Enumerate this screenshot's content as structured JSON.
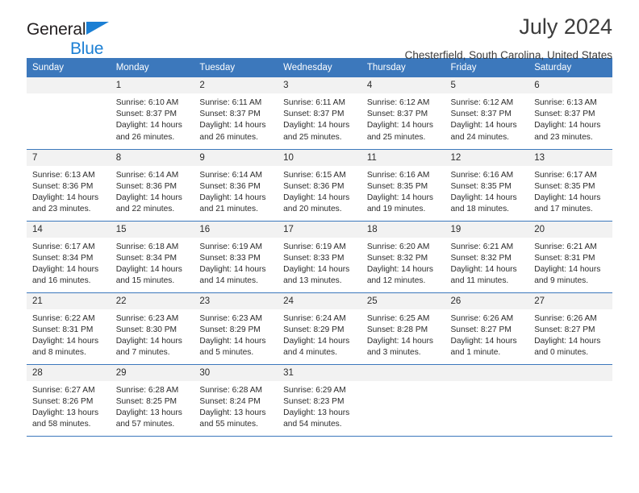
{
  "brand": {
    "name_top": "General",
    "name_bottom": "Blue",
    "triangle_color": "#1b7fd4"
  },
  "header": {
    "title": "July 2024",
    "subtitle": "Chesterfield, South Carolina, United States",
    "accent_color": "#3c78bc"
  },
  "calendar": {
    "weekdays": [
      "Sunday",
      "Monday",
      "Tuesday",
      "Wednesday",
      "Thursday",
      "Friday",
      "Saturday"
    ],
    "labels": {
      "sunrise": "Sunrise:",
      "sunset": "Sunset:",
      "daylight": "Daylight:"
    },
    "weeks": [
      [
        {
          "day": "",
          "blank": true
        },
        {
          "day": "1",
          "sunrise": "Sunrise: 6:10 AM",
          "sunset": "Sunset: 8:37 PM",
          "daylight_1": "Daylight: 14 hours",
          "daylight_2": "and 26 minutes."
        },
        {
          "day": "2",
          "sunrise": "Sunrise: 6:11 AM",
          "sunset": "Sunset: 8:37 PM",
          "daylight_1": "Daylight: 14 hours",
          "daylight_2": "and 26 minutes."
        },
        {
          "day": "3",
          "sunrise": "Sunrise: 6:11 AM",
          "sunset": "Sunset: 8:37 PM",
          "daylight_1": "Daylight: 14 hours",
          "daylight_2": "and 25 minutes."
        },
        {
          "day": "4",
          "sunrise": "Sunrise: 6:12 AM",
          "sunset": "Sunset: 8:37 PM",
          "daylight_1": "Daylight: 14 hours",
          "daylight_2": "and 25 minutes."
        },
        {
          "day": "5",
          "sunrise": "Sunrise: 6:12 AM",
          "sunset": "Sunset: 8:37 PM",
          "daylight_1": "Daylight: 14 hours",
          "daylight_2": "and 24 minutes."
        },
        {
          "day": "6",
          "sunrise": "Sunrise: 6:13 AM",
          "sunset": "Sunset: 8:37 PM",
          "daylight_1": "Daylight: 14 hours",
          "daylight_2": "and 23 minutes."
        }
      ],
      [
        {
          "day": "7",
          "sunrise": "Sunrise: 6:13 AM",
          "sunset": "Sunset: 8:36 PM",
          "daylight_1": "Daylight: 14 hours",
          "daylight_2": "and 23 minutes."
        },
        {
          "day": "8",
          "sunrise": "Sunrise: 6:14 AM",
          "sunset": "Sunset: 8:36 PM",
          "daylight_1": "Daylight: 14 hours",
          "daylight_2": "and 22 minutes."
        },
        {
          "day": "9",
          "sunrise": "Sunrise: 6:14 AM",
          "sunset": "Sunset: 8:36 PM",
          "daylight_1": "Daylight: 14 hours",
          "daylight_2": "and 21 minutes."
        },
        {
          "day": "10",
          "sunrise": "Sunrise: 6:15 AM",
          "sunset": "Sunset: 8:36 PM",
          "daylight_1": "Daylight: 14 hours",
          "daylight_2": "and 20 minutes."
        },
        {
          "day": "11",
          "sunrise": "Sunrise: 6:16 AM",
          "sunset": "Sunset: 8:35 PM",
          "daylight_1": "Daylight: 14 hours",
          "daylight_2": "and 19 minutes."
        },
        {
          "day": "12",
          "sunrise": "Sunrise: 6:16 AM",
          "sunset": "Sunset: 8:35 PM",
          "daylight_1": "Daylight: 14 hours",
          "daylight_2": "and 18 minutes."
        },
        {
          "day": "13",
          "sunrise": "Sunrise: 6:17 AM",
          "sunset": "Sunset: 8:35 PM",
          "daylight_1": "Daylight: 14 hours",
          "daylight_2": "and 17 minutes."
        }
      ],
      [
        {
          "day": "14",
          "sunrise": "Sunrise: 6:17 AM",
          "sunset": "Sunset: 8:34 PM",
          "daylight_1": "Daylight: 14 hours",
          "daylight_2": "and 16 minutes."
        },
        {
          "day": "15",
          "sunrise": "Sunrise: 6:18 AM",
          "sunset": "Sunset: 8:34 PM",
          "daylight_1": "Daylight: 14 hours",
          "daylight_2": "and 15 minutes."
        },
        {
          "day": "16",
          "sunrise": "Sunrise: 6:19 AM",
          "sunset": "Sunset: 8:33 PM",
          "daylight_1": "Daylight: 14 hours",
          "daylight_2": "and 14 minutes."
        },
        {
          "day": "17",
          "sunrise": "Sunrise: 6:19 AM",
          "sunset": "Sunset: 8:33 PM",
          "daylight_1": "Daylight: 14 hours",
          "daylight_2": "and 13 minutes."
        },
        {
          "day": "18",
          "sunrise": "Sunrise: 6:20 AM",
          "sunset": "Sunset: 8:32 PM",
          "daylight_1": "Daylight: 14 hours",
          "daylight_2": "and 12 minutes."
        },
        {
          "day": "19",
          "sunrise": "Sunrise: 6:21 AM",
          "sunset": "Sunset: 8:32 PM",
          "daylight_1": "Daylight: 14 hours",
          "daylight_2": "and 11 minutes."
        },
        {
          "day": "20",
          "sunrise": "Sunrise: 6:21 AM",
          "sunset": "Sunset: 8:31 PM",
          "daylight_1": "Daylight: 14 hours",
          "daylight_2": "and 9 minutes."
        }
      ],
      [
        {
          "day": "21",
          "sunrise": "Sunrise: 6:22 AM",
          "sunset": "Sunset: 8:31 PM",
          "daylight_1": "Daylight: 14 hours",
          "daylight_2": "and 8 minutes."
        },
        {
          "day": "22",
          "sunrise": "Sunrise: 6:23 AM",
          "sunset": "Sunset: 8:30 PM",
          "daylight_1": "Daylight: 14 hours",
          "daylight_2": "and 7 minutes."
        },
        {
          "day": "23",
          "sunrise": "Sunrise: 6:23 AM",
          "sunset": "Sunset: 8:29 PM",
          "daylight_1": "Daylight: 14 hours",
          "daylight_2": "and 5 minutes."
        },
        {
          "day": "24",
          "sunrise": "Sunrise: 6:24 AM",
          "sunset": "Sunset: 8:29 PM",
          "daylight_1": "Daylight: 14 hours",
          "daylight_2": "and 4 minutes."
        },
        {
          "day": "25",
          "sunrise": "Sunrise: 6:25 AM",
          "sunset": "Sunset: 8:28 PM",
          "daylight_1": "Daylight: 14 hours",
          "daylight_2": "and 3 minutes."
        },
        {
          "day": "26",
          "sunrise": "Sunrise: 6:26 AM",
          "sunset": "Sunset: 8:27 PM",
          "daylight_1": "Daylight: 14 hours",
          "daylight_2": "and 1 minute."
        },
        {
          "day": "27",
          "sunrise": "Sunrise: 6:26 AM",
          "sunset": "Sunset: 8:27 PM",
          "daylight_1": "Daylight: 14 hours",
          "daylight_2": "and 0 minutes."
        }
      ],
      [
        {
          "day": "28",
          "sunrise": "Sunrise: 6:27 AM",
          "sunset": "Sunset: 8:26 PM",
          "daylight_1": "Daylight: 13 hours",
          "daylight_2": "and 58 minutes."
        },
        {
          "day": "29",
          "sunrise": "Sunrise: 6:28 AM",
          "sunset": "Sunset: 8:25 PM",
          "daylight_1": "Daylight: 13 hours",
          "daylight_2": "and 57 minutes."
        },
        {
          "day": "30",
          "sunrise": "Sunrise: 6:28 AM",
          "sunset": "Sunset: 8:24 PM",
          "daylight_1": "Daylight: 13 hours",
          "daylight_2": "and 55 minutes."
        },
        {
          "day": "31",
          "sunrise": "Sunrise: 6:29 AM",
          "sunset": "Sunset: 8:23 PM",
          "daylight_1": "Daylight: 13 hours",
          "daylight_2": "and 54 minutes."
        },
        {
          "day": "",
          "blank": true
        },
        {
          "day": "",
          "blank": true
        },
        {
          "day": "",
          "blank": true
        }
      ]
    ]
  }
}
